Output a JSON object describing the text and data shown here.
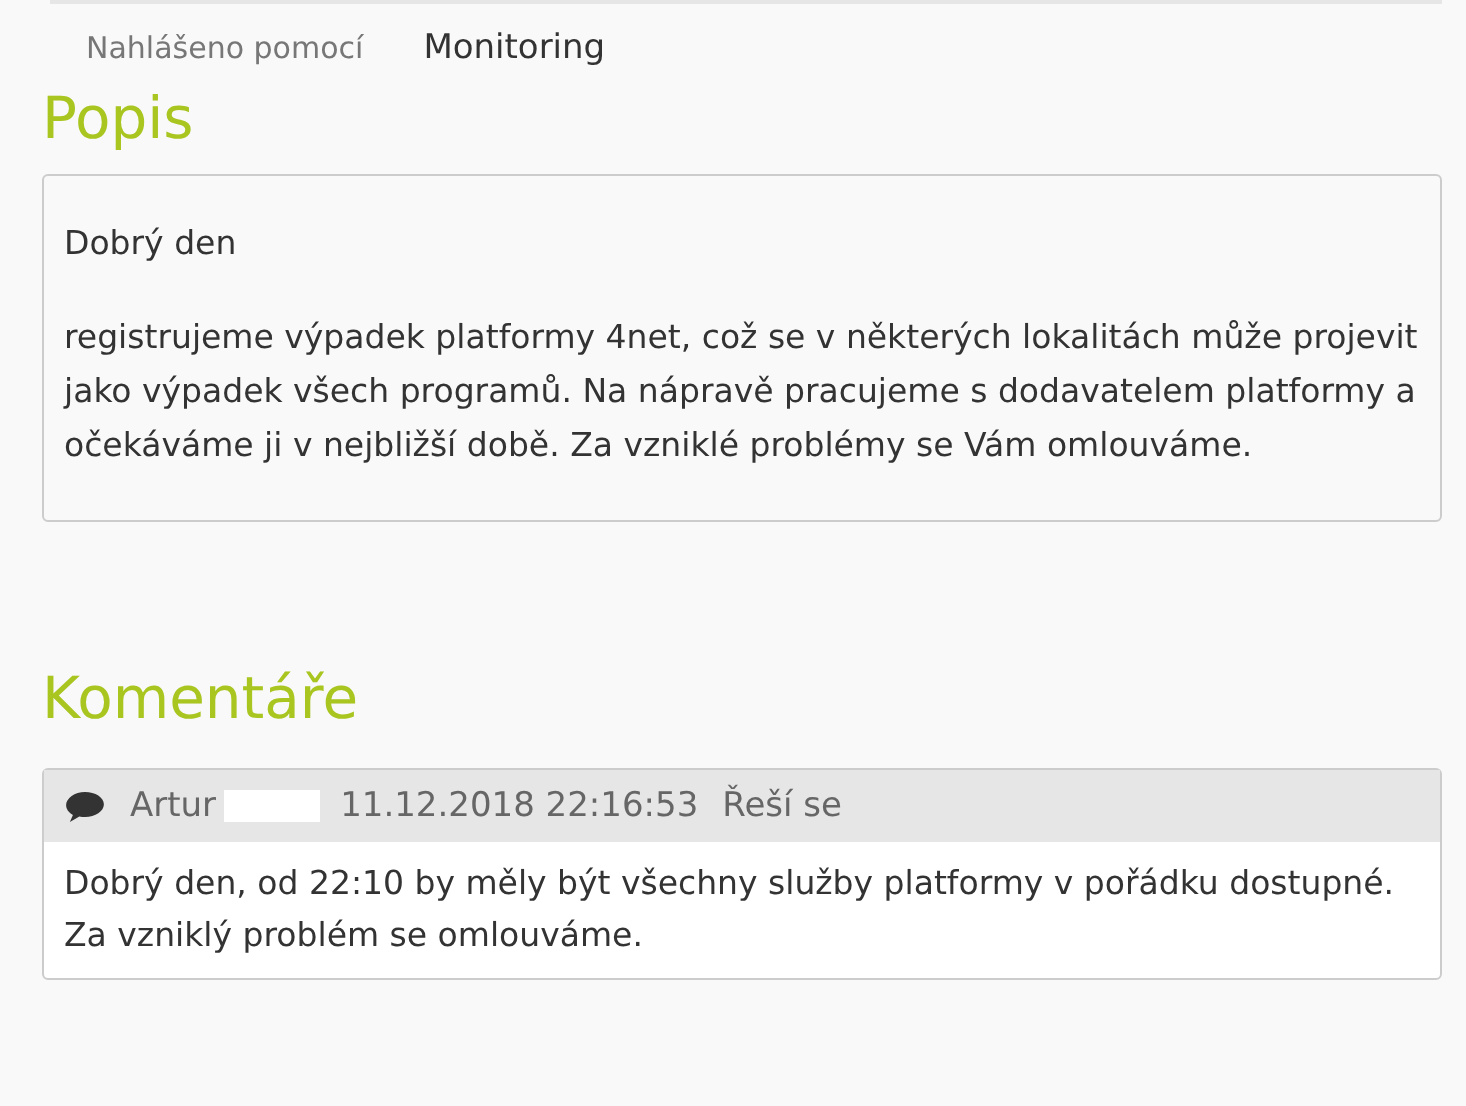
{
  "tabs": [
    {
      "label": "Nahlášeno pomocí",
      "selected": false
    },
    {
      "label": "Monitoring",
      "selected": true
    }
  ],
  "description": {
    "heading": "Popis",
    "paragraphs": [
      "Dobrý den",
      "registrujeme výpadek platformy 4net, což se v některých lokalitách může projevit jako výpadek všech programů. Na nápravě pracujeme s dodavatelem platformy a očekáváme ji v nejbližší době. Za vzniklé problémy se Vám omlouváme."
    ]
  },
  "comments": {
    "heading": "Komentáře",
    "items": [
      {
        "author": "Artur",
        "timestamp": "11.12.2018 22:16:53",
        "status": "Řeší se",
        "text": "Dobrý den, od 22:10 by měly být všechny služby platformy v pořádku dostupné. Za vzniklý problém se omlouváme."
      }
    ]
  }
}
